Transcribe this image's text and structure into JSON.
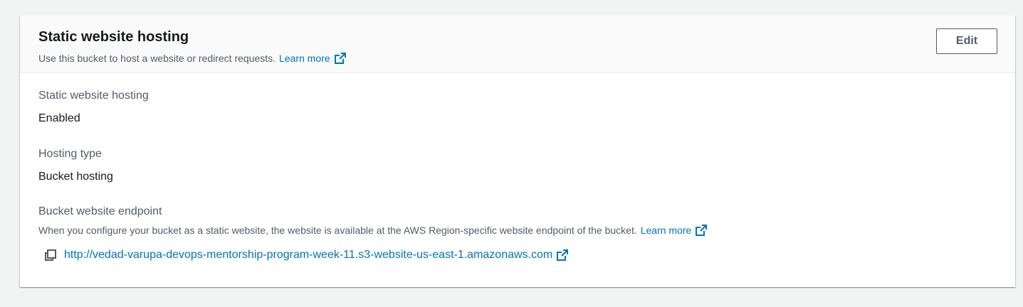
{
  "panel": {
    "title": "Static website hosting",
    "description": "Use this bucket to host a website or redirect requests.",
    "learn_more_label": "Learn more",
    "edit_label": "Edit"
  },
  "fields": {
    "hosting": {
      "label": "Static website hosting",
      "value": "Enabled"
    },
    "hosting_type": {
      "label": "Hosting type",
      "value": "Bucket hosting"
    },
    "endpoint": {
      "label": "Bucket website endpoint",
      "description": "When you configure your bucket as a static website, the website is available at the AWS Region-specific website endpoint of the bucket.",
      "learn_more_label": "Learn more",
      "url": "http://vedad-varupa-devops-mentorship-program-week-11.s3-website-us-east-1.amazonaws.com"
    }
  },
  "icons": {
    "external_link": "external-link-icon",
    "copy": "copy-icon"
  },
  "colors": {
    "link": "#0073bb",
    "text_primary": "#16191f",
    "text_secondary": "#545b64",
    "page_background": "#f2f3f3",
    "header_background": "#fafafa"
  }
}
